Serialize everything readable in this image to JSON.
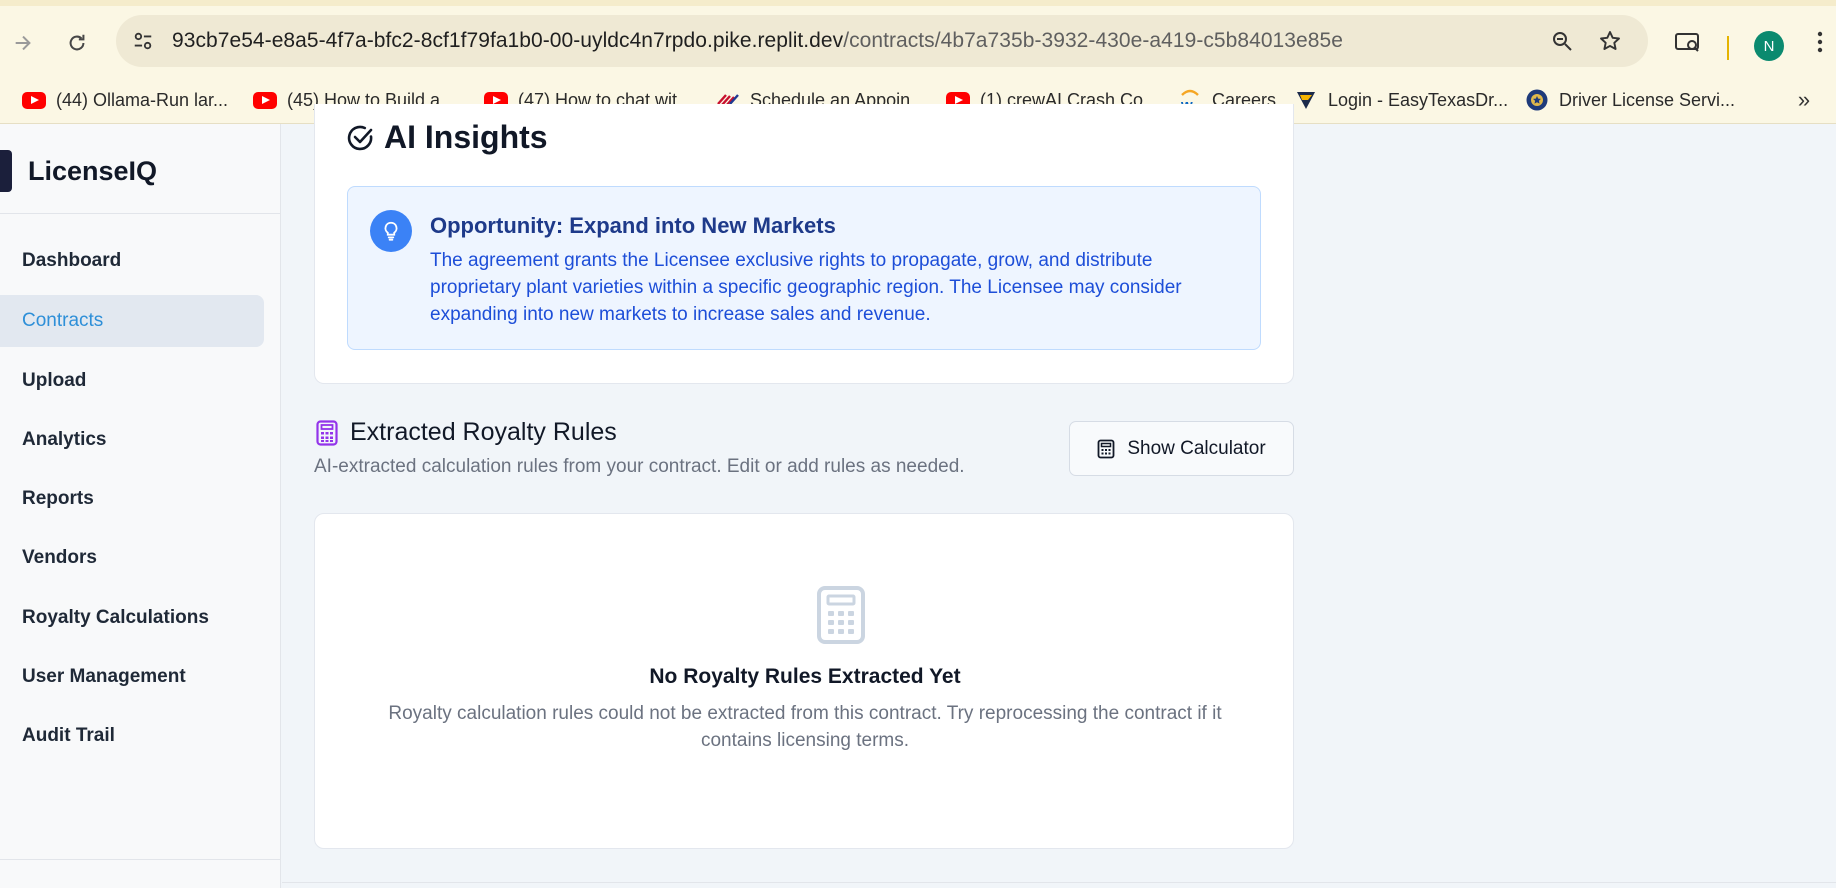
{
  "browser": {
    "url_host": "93cb7e54-e8a5-4f7a-bfc2-8cf1f79fa1b0-00-uyldc4n7rpdo.pike.replit.dev",
    "url_path": "/contracts/4b7a735b-3932-430e-a419-c5b84013e85e",
    "profile_initial": "N",
    "icons": {
      "forward": "arrow-right-icon",
      "reload": "reload-icon",
      "site_info": "tune-icon",
      "zoom": "zoom-icon",
      "bookmark": "star-icon",
      "cast": "media-icon",
      "menu": "kebab-menu-icon"
    }
  },
  "bookmarks": [
    {
      "label": "(44) Ollama-Run lar...",
      "icon": "youtube-icon"
    },
    {
      "label": "(45) How to Build a...",
      "icon": "youtube-icon"
    },
    {
      "label": "(47) How to chat wit...",
      "icon": "youtube-icon"
    },
    {
      "label": "Schedule an Appoin...",
      "icon": "flag-icon"
    },
    {
      "label": "(1) crewAI Crash Co...",
      "icon": "youtube-icon"
    },
    {
      "label": "Careers",
      "icon": "workday-icon"
    },
    {
      "label": "Login - EasyTexasDr...",
      "icon": "shield-icon"
    },
    {
      "label": "Driver License Servi...",
      "icon": "seal-icon"
    }
  ],
  "bookmarks_more": "»",
  "app": {
    "name": "LicenseIQ",
    "nav": [
      {
        "label": "Dashboard",
        "active": false
      },
      {
        "label": "Contracts",
        "active": true
      },
      {
        "label": "Upload",
        "active": false
      },
      {
        "label": "Analytics",
        "active": false
      },
      {
        "label": "Reports",
        "active": false
      },
      {
        "label": "Vendors",
        "active": false
      },
      {
        "label": "Royalty Calculations",
        "active": false
      },
      {
        "label": "User Management",
        "active": false
      },
      {
        "label": "Audit Trail",
        "active": false
      }
    ]
  },
  "insights": {
    "title": "AI Insights",
    "item": {
      "title": "Opportunity: Expand into New Markets",
      "body": "The agreement grants the Licensee exclusive rights to propagate, grow, and distribute proprietary plant varieties within a specific geographic region. The Licensee may consider expanding into new markets to increase sales and revenue."
    }
  },
  "royalty_rules": {
    "title": "Extracted Royalty Rules",
    "subtitle": "AI-extracted calculation rules from your contract. Edit or add rules as needed.",
    "show_calculator": "Show Calculator",
    "empty_title": "No Royalty Rules Extracted Yet",
    "empty_body": "Royalty calculation rules could not be extracted from this contract. Try reprocessing the contract if it contains licensing terms."
  },
  "colors": {
    "accent": "#2e8fd8",
    "insight_bg": "#eef5ff",
    "insight_text": "#1d4ed8",
    "rules_icon": "#9333ea"
  }
}
